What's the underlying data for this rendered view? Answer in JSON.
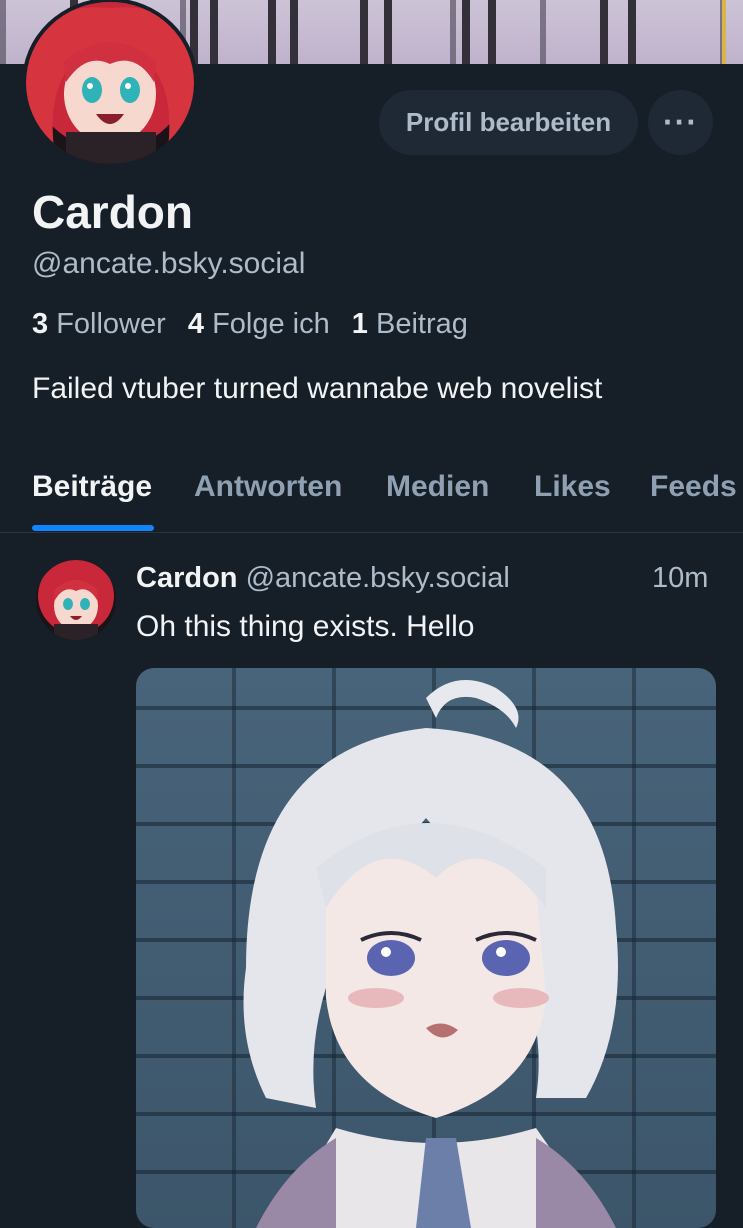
{
  "profile": {
    "edit_button": "Profil bearbeiten",
    "more_button": "···",
    "name": "Cardon",
    "handle": "@ancate.bsky.social",
    "followers_count": "3",
    "followers_label": "Follower",
    "following_count": "4",
    "following_label": "Folge ich",
    "posts_count": "1",
    "posts_label": "Beitrag",
    "bio": "Failed vtuber turned wannabe web novelist"
  },
  "tabs": [
    {
      "label": "Beiträge",
      "active": true
    },
    {
      "label": "Antworten",
      "active": false
    },
    {
      "label": "Medien",
      "active": false
    },
    {
      "label": "Likes",
      "active": false
    },
    {
      "label": "Feeds",
      "active": false
    }
  ],
  "post": {
    "author_name": "Cardon",
    "author_handle": "@ancate.bsky.social",
    "time": "10m",
    "text": "Oh this thing exists. Hello"
  },
  "colors": {
    "background": "#161e27",
    "accent": "#1185fe",
    "secondary_text": "#aebbc9"
  }
}
